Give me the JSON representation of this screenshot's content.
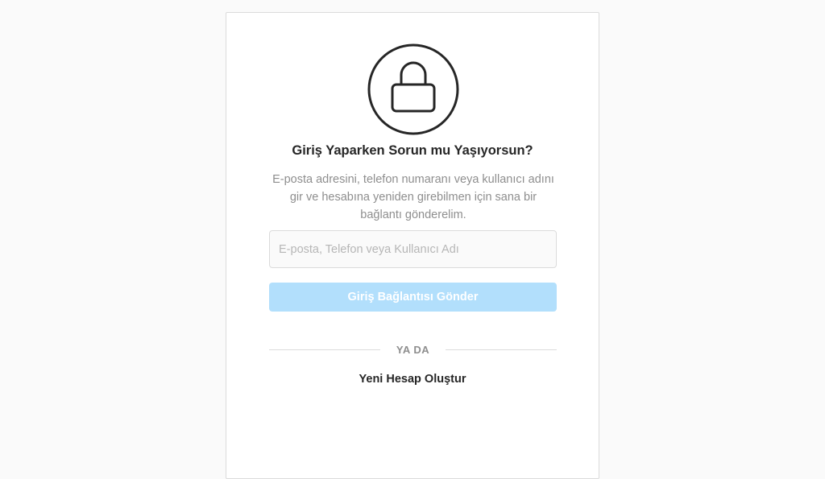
{
  "page": {
    "title": "Giriş Yaparken Sorun mu Yaşıyorsun?",
    "description": "E-posta adresini, telefon numaranı veya kullanıcı adını gir ve hesabına yeniden girebilmen için sana bir bağlantı gönderelim.",
    "lock_icon": "lock-icon"
  },
  "form": {
    "input_placeholder": "E-posta, Telefon veya Kullanıcı Adı",
    "input_value": "",
    "send_button_label": "Giriş Bağlantısı Gönder"
  },
  "divider": {
    "label": "YA DA"
  },
  "links": {
    "create_account": "Yeni Hesap Oluştur"
  },
  "colors": {
    "button_disabled": "#b2dffc",
    "text_primary": "#262626",
    "text_secondary": "#8e8e8e",
    "border": "#dbdbdb"
  }
}
